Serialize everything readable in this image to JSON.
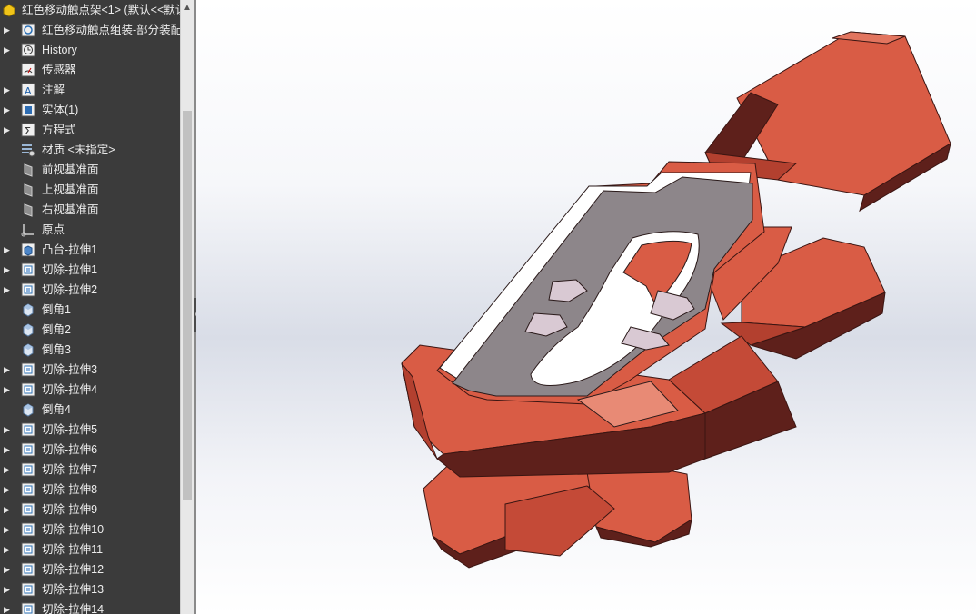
{
  "feature_tree": {
    "root_label": "红色移动触点架<1> (默认<<默认",
    "items": [
      {
        "label": "红色移动触点组装-部分装配",
        "icon": "assembly-icon",
        "expandable": true
      },
      {
        "label": "History",
        "icon": "history-icon",
        "expandable": true
      },
      {
        "label": "传感器",
        "icon": "sensor-icon",
        "expandable": false
      },
      {
        "label": "注解",
        "icon": "annotation-icon",
        "expandable": true
      },
      {
        "label": "实体(1)",
        "icon": "solid-bodies-icon",
        "expandable": true
      },
      {
        "label": "方程式",
        "icon": "equations-icon",
        "expandable": true
      },
      {
        "label": "材质 <未指定>",
        "icon": "material-icon",
        "expandable": false
      },
      {
        "label": "前视基准面",
        "icon": "plane-icon",
        "expandable": false
      },
      {
        "label": "上视基准面",
        "icon": "plane-icon",
        "expandable": false
      },
      {
        "label": "右视基准面",
        "icon": "plane-icon",
        "expandable": false
      },
      {
        "label": "原点",
        "icon": "origin-icon",
        "expandable": false
      },
      {
        "label": "凸台-拉伸1",
        "icon": "boss-extrude-icon",
        "expandable": true
      },
      {
        "label": "切除-拉伸1",
        "icon": "cut-extrude-icon",
        "expandable": true
      },
      {
        "label": "切除-拉伸2",
        "icon": "cut-extrude-icon",
        "expandable": true
      },
      {
        "label": "倒角1",
        "icon": "chamfer-icon",
        "expandable": false
      },
      {
        "label": "倒角2",
        "icon": "chamfer-icon",
        "expandable": false
      },
      {
        "label": "倒角3",
        "icon": "chamfer-icon",
        "expandable": false
      },
      {
        "label": "切除-拉伸3",
        "icon": "cut-extrude-icon",
        "expandable": true
      },
      {
        "label": "切除-拉伸4",
        "icon": "cut-extrude-icon",
        "expandable": true
      },
      {
        "label": "倒角4",
        "icon": "chamfer-icon",
        "expandable": false
      },
      {
        "label": "切除-拉伸5",
        "icon": "cut-extrude-icon",
        "expandable": true
      },
      {
        "label": "切除-拉伸6",
        "icon": "cut-extrude-icon",
        "expandable": true
      },
      {
        "label": "切除-拉伸7",
        "icon": "cut-extrude-icon",
        "expandable": true
      },
      {
        "label": "切除-拉伸8",
        "icon": "cut-extrude-icon",
        "expandable": true
      },
      {
        "label": "切除-拉伸9",
        "icon": "cut-extrude-icon",
        "expandable": true
      },
      {
        "label": "切除-拉伸10",
        "icon": "cut-extrude-icon",
        "expandable": true
      },
      {
        "label": "切除-拉伸11",
        "icon": "cut-extrude-icon",
        "expandable": true
      },
      {
        "label": "切除-拉伸12",
        "icon": "cut-extrude-icon",
        "expandable": true
      },
      {
        "label": "切除-拉伸13",
        "icon": "cut-extrude-icon",
        "expandable": true
      },
      {
        "label": "切除-拉伸14",
        "icon": "cut-extrude-icon",
        "expandable": true
      }
    ]
  },
  "colors": {
    "panel_bg": "#3b3b3b",
    "model_red": "#d95c45",
    "model_red_dark": "#5e201b",
    "model_red_mid": "#b3402f",
    "model_gray": "#8d868a",
    "model_white": "#ffffff"
  }
}
